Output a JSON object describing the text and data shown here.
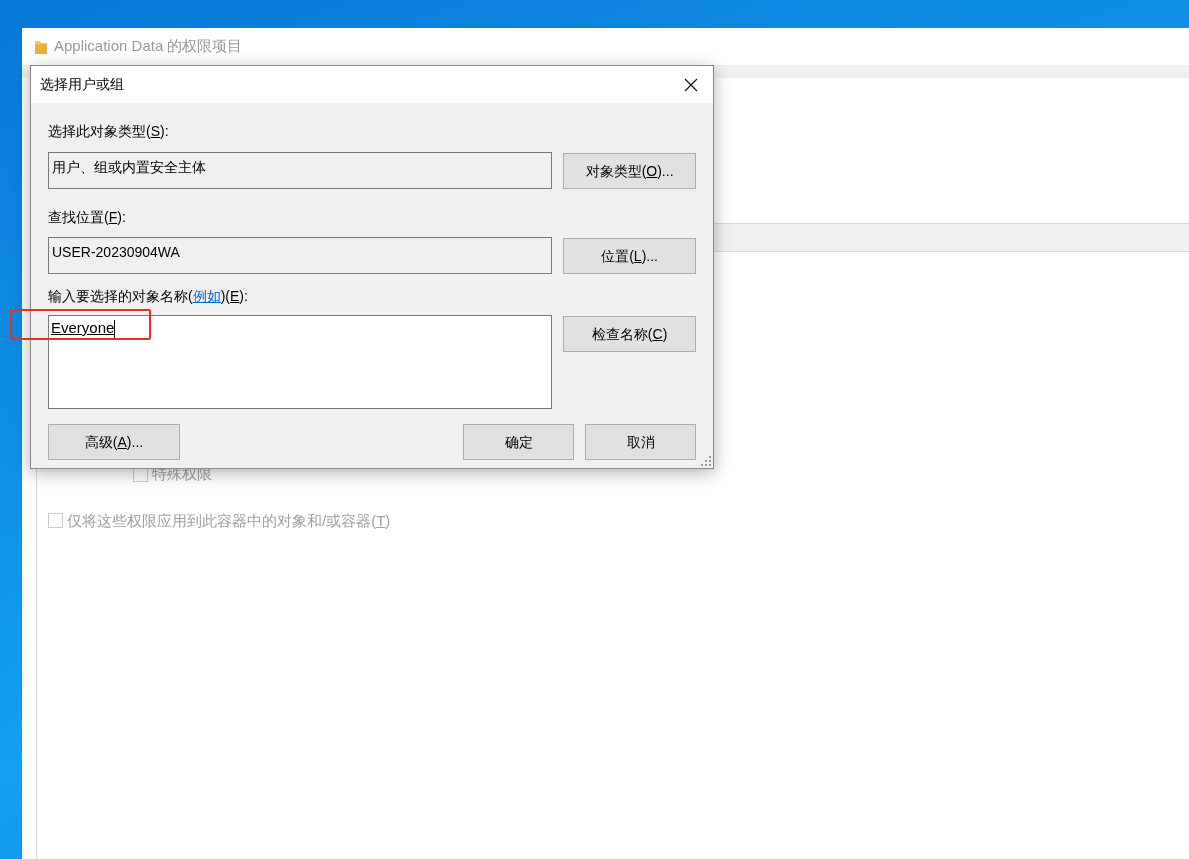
{
  "background_window": {
    "title": "Application Data 的权限项目",
    "checkboxes": [
      {
        "kind": "indented",
        "text_before": "特殊权限",
        "checked": false,
        "disabled": true
      },
      {
        "kind": "plain",
        "text_before": "仅将这些权限应用到此容器中的对象和/或容器(",
        "access_key": "T",
        "text_after": ")",
        "checked": false,
        "disabled": true
      }
    ]
  },
  "dialog": {
    "title": "选择用户或组",
    "object_type": {
      "label": {
        "before": "选择此对象类型(",
        "access_key": "S",
        "after": "):"
      },
      "value": "用户、组或内置安全主体",
      "button": {
        "before": "对象类型(",
        "access_key": "O",
        "after": ")..."
      }
    },
    "location": {
      "label": {
        "before": "查找位置(",
        "access_key": "F",
        "after": "):"
      },
      "value": "USER-20230904WA",
      "button": {
        "before": "位置(",
        "access_key": "L",
        "after": ")..."
      }
    },
    "names": {
      "label": {
        "before": "输入要选择的对象名称(",
        "link": "例如",
        "middle": ")(",
        "access_key": "E",
        "after": "):"
      },
      "value": "Everyone",
      "highlighted": true,
      "button": {
        "before": "检查名称(",
        "access_key": "C",
        "after": ")"
      }
    },
    "buttons": [
      {
        "kind": "left",
        "before": "高级(",
        "access_key": "A",
        "after": ")..."
      },
      {
        "kind": "right",
        "before": "确定"
      },
      {
        "kind": "right",
        "before": "取消"
      }
    ]
  }
}
